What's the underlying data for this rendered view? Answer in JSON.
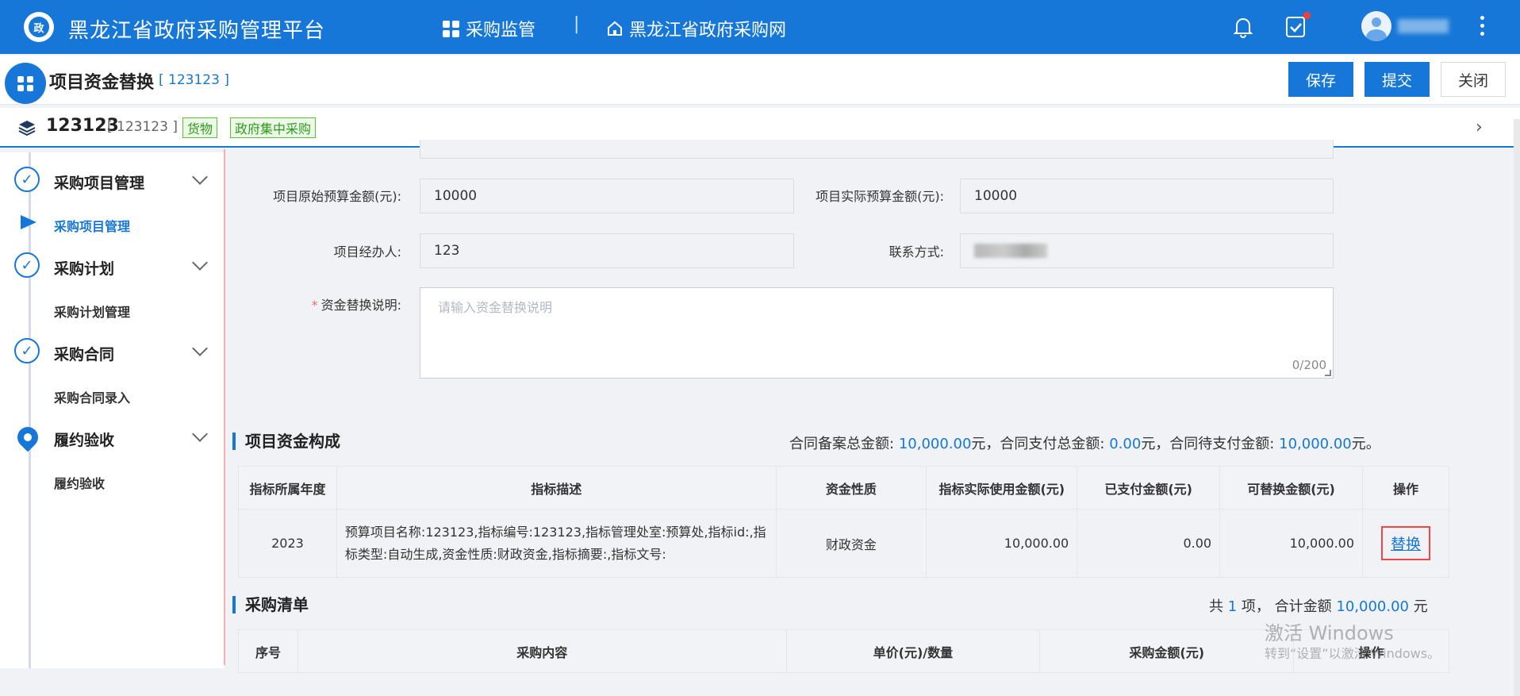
{
  "topbar": {
    "app_title": "黑龙江省政府采购管理平台",
    "nav_monitor": "采购监管",
    "nav_separator": "|",
    "nav_website": "黑龙江省政府采购网",
    "logo_glyph": "政"
  },
  "header": {
    "page_title": "项目资金替换",
    "page_code": "[ 123123 ]",
    "save_label": "保存",
    "submit_label": "提交",
    "close_label": "关闭"
  },
  "project": {
    "name": "123123",
    "code": "[ 123123 ]",
    "tag_goods": "货物",
    "tag_central": "政府集中采购",
    "chevron": "›"
  },
  "sidebar": {
    "sections": [
      {
        "label": "采购项目管理",
        "sub": "采购项目管理",
        "icon": "check-circle-icon",
        "active_sub": true
      },
      {
        "label": "采购计划",
        "sub": "采购计划管理",
        "icon": "check-circle-icon"
      },
      {
        "label": "采购合同",
        "sub": "采购合同录入",
        "icon": "check-circle-icon"
      },
      {
        "label": "履约验收",
        "sub": "履约验收",
        "icon": "location-pin-icon"
      }
    ],
    "check_glyph": "✓"
  },
  "form": {
    "original_budget_label": "项目原始预算金额(元):",
    "original_budget_value": "10000",
    "actual_budget_label": "项目实际预算金额(元):",
    "actual_budget_value": "10000",
    "handler_label": "项目经办人:",
    "handler_value": "123",
    "contact_label": "联系方式:",
    "replace_desc_label": "资金替换说明:",
    "required_mark": "*",
    "replace_desc_placeholder": "请输入资金替换说明",
    "replace_desc_count": "0/200"
  },
  "fund": {
    "title": "项目资金构成",
    "summary_prefix": "合同备案总金额:",
    "summary_filed": "10,000.00",
    "summary_mid1": "元，合同支付总金额:",
    "summary_paid": "0.00",
    "summary_mid2": "元，合同待支付金额:",
    "summary_pending": "10,000.00",
    "summary_suffix": "元。",
    "columns": [
      "指标所属年度",
      "指标描述",
      "资金性质",
      "指标实际使用金额(元)",
      "已支付金额(元)",
      "可替换金额(元)",
      "操作"
    ],
    "rows": [
      {
        "year": "2023",
        "desc": "预算项目名称:123123,指标编号:123123,指标管理处室:预算处,指标id:,指标类型:自动生成,资金性质:财政资金,指标摘要:,指标文号:",
        "nature": "财政资金",
        "used": "10,000.00",
        "paid": "0.00",
        "replaceable": "10,000.00",
        "action": "替换"
      }
    ]
  },
  "purchase": {
    "title": "采购清单",
    "total_prefix": "共",
    "total_count": "1",
    "total_mid": "项， 合计金额",
    "total_amount": "10,000.00",
    "total_suffix": "元",
    "columns": [
      "序号",
      "采购内容",
      "单价(元)/数量",
      "采购金额(元)",
      "操作"
    ]
  },
  "watermark": {
    "line1": "激活 Windows",
    "line2": "转到“设置”以激活 Windows。"
  },
  "colors": {
    "primary": "#1677d8",
    "tag_green": "#2e9a1c",
    "highlight_red": "#f24545"
  }
}
